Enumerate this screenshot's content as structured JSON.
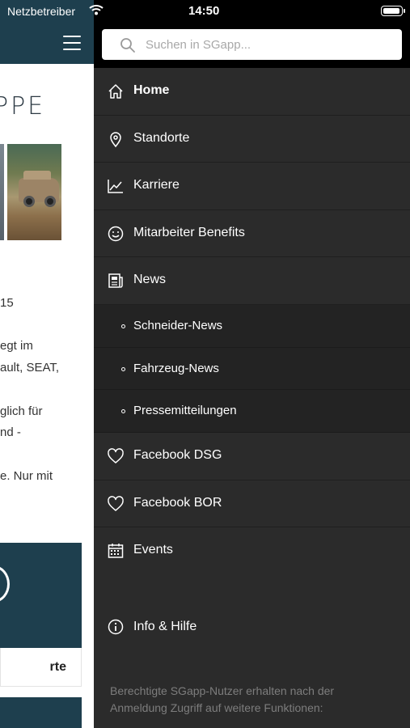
{
  "status_bar": {
    "carrier": "Netzbetreiber",
    "time": "14:50"
  },
  "background_page": {
    "logo_text": "PPE",
    "text_fragments": [
      "15",
      "egt im",
      "ault, SEAT,",
      "glich für",
      "nd -",
      "e. Nur mit"
    ],
    "tile_caption": "rte"
  },
  "drawer": {
    "search": {
      "placeholder": "Suchen in SGapp..."
    },
    "menu": [
      {
        "label": "Home",
        "icon": "home-icon",
        "active": true
      },
      {
        "label": "Standorte",
        "icon": "location-pin-icon"
      },
      {
        "label": "Karriere",
        "icon": "chart-line-icon"
      },
      {
        "label": "Mitarbeiter Benefits",
        "icon": "smiley-icon"
      },
      {
        "label": "News",
        "icon": "newspaper-icon"
      }
    ],
    "news_sub": [
      {
        "label": "Schneider-News"
      },
      {
        "label": "Fahrzeug-News"
      },
      {
        "label": "Pressemitteilungen"
      }
    ],
    "menu2": [
      {
        "label": "Facebook DSG",
        "icon": "heart-icon"
      },
      {
        "label": "Facebook BOR",
        "icon": "heart-icon"
      },
      {
        "label": "Events",
        "icon": "calendar-icon"
      }
    ],
    "info": {
      "label": "Info & Hilfe",
      "icon": "info-icon"
    },
    "footer_note": "Berechtigte SGapp-Nutzer erhalten nach der Anmeldung Zugriff auf weitere Funktionen:"
  },
  "colors": {
    "header_teal": "#1e3f4e",
    "drawer_bg": "#2b2b2b",
    "submenu_bg": "#232323"
  }
}
